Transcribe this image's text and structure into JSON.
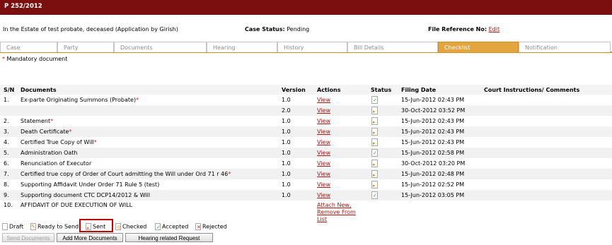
{
  "window": {
    "title": "P 252/2012"
  },
  "info": {
    "estate": "In the Estate of test probate, deceased (Application by Girish)",
    "status_label": "Case Status:",
    "status_value": "Pending",
    "fileref_label": "File Reference No:",
    "fileref_link": "Edit"
  },
  "tabs": [
    "Case",
    "Party",
    "Documents",
    "Hearing",
    "History",
    "Bill Details",
    "Checklist",
    "Notification"
  ],
  "active_tab": "Checklist",
  "mandatory_note": {
    "star": "*",
    "text": "Mandatory document"
  },
  "table": {
    "headers": [
      "S/N",
      "Documents",
      "Version",
      "Actions",
      "Status",
      "Filing Date",
      "Court Instructions/ Comments"
    ],
    "rows": [
      {
        "sn": "1.",
        "doc": "Ex-parte Originating Summons (Probate)",
        "mandatory": true,
        "version": "1.0",
        "action": "View",
        "status": "accepted",
        "date": "15-Jun-2012 02:43 PM",
        "comment": ""
      },
      {
        "sn": "",
        "doc": "",
        "mandatory": false,
        "version": "2.0",
        "action": "View",
        "status": "sent",
        "date": "30-Oct-2012 03:52 PM",
        "comment": ""
      },
      {
        "sn": "2.",
        "doc": "Statement",
        "mandatory": true,
        "version": "1.0",
        "action": "View",
        "status": "sent",
        "date": "15-Jun-2012 02:43 PM",
        "comment": ""
      },
      {
        "sn": "3.",
        "doc": "Death Certificate",
        "mandatory": true,
        "version": "1.0",
        "action": "View",
        "status": "sent",
        "date": "15-Jun-2012 02:43 PM",
        "comment": ""
      },
      {
        "sn": "4.",
        "doc": "Certified True Copy of Will",
        "mandatory": true,
        "version": "1.0",
        "action": "View",
        "status": "sent",
        "date": "15-Jun-2012 02:43 PM",
        "comment": ""
      },
      {
        "sn": "5.",
        "doc": "Administration Oath",
        "mandatory": false,
        "version": "1.0",
        "action": "View",
        "status": "accepted",
        "date": "15-Jun-2012 02:58 PM",
        "comment": ""
      },
      {
        "sn": "6.",
        "doc": "Renunciation of Executor",
        "mandatory": false,
        "version": "1.0",
        "action": "View",
        "status": "sent",
        "date": "30-Oct-2012 03:20 PM",
        "comment": ""
      },
      {
        "sn": "7.",
        "doc": "Certified true copy of Order of Court admitting the Will under Ord 71 r 46",
        "mandatory": true,
        "version": "1.0",
        "action": "View",
        "status": "sent",
        "date": "15-Jun-2012 02:48 PM",
        "comment": ""
      },
      {
        "sn": "8.",
        "doc": "Supporting Affidavit Under Order 71 Rule 5 (test)",
        "mandatory": false,
        "version": "1.0",
        "action": "View",
        "status": "sent",
        "date": "15-Jun-2012 02:52 PM",
        "comment": ""
      },
      {
        "sn": "9.",
        "doc": "Supporting document CTC DCP14/2012 & Will",
        "mandatory": false,
        "version": "1.0",
        "action": "View",
        "status": "accepted",
        "date": "15-Jun-2012 03:05 PM",
        "comment": ""
      }
    ],
    "last_row": {
      "sn": "10.",
      "doc": "AFFIDAVIT OF DUE EXECUTION OF WILL",
      "attach": "Attach New,",
      "remove": "Remove From",
      "list": "List"
    }
  },
  "legend": [
    {
      "icon": "draft-icon",
      "label": "Draft"
    },
    {
      "icon": "ready-to-send-icon",
      "label": "Ready to Send"
    },
    {
      "icon": "sent-icon",
      "label": "Sent"
    },
    {
      "icon": "checked-icon",
      "label": "Checked"
    },
    {
      "icon": "accepted-icon",
      "label": "Accepted"
    },
    {
      "icon": "rejected-icon",
      "label": "Rejected"
    }
  ],
  "buttons": {
    "send": "Send Documents",
    "add_more": "Add More Documents",
    "hearing": "Hearing related Request"
  },
  "colors": {
    "title_bar": "#7b0f0f",
    "active_tab": "#e4a43e",
    "link": "#b01717",
    "mandatory_star": "#d01a1a",
    "highlight_box": "#c00000"
  }
}
